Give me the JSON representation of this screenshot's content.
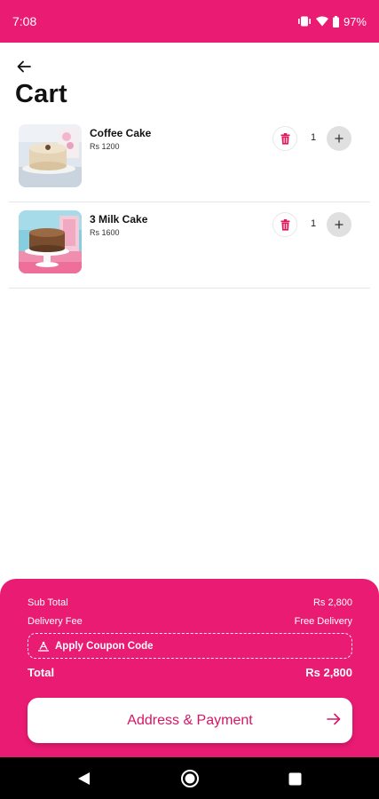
{
  "status_bar": {
    "time": "7:08",
    "battery": "97%"
  },
  "header": {
    "title": "Cart"
  },
  "cart": {
    "items": [
      {
        "name": "Coffee Cake",
        "price": "Rs 1200",
        "quantity": "1"
      },
      {
        "name": "3 Milk Cake",
        "price": "Rs 1600",
        "quantity": "1"
      }
    ]
  },
  "summary": {
    "subtotal_label": "Sub Total",
    "subtotal_value": "Rs 2,800",
    "delivery_label": "Delivery Fee",
    "delivery_value": "Free Delivery",
    "coupon_label": "Apply Coupon Code",
    "total_label": "Total",
    "total_value": "Rs 2,800"
  },
  "cta": {
    "label": "Address & Payment"
  },
  "colors": {
    "brand": "#ea1b73",
    "accent_text": "#d81564"
  }
}
